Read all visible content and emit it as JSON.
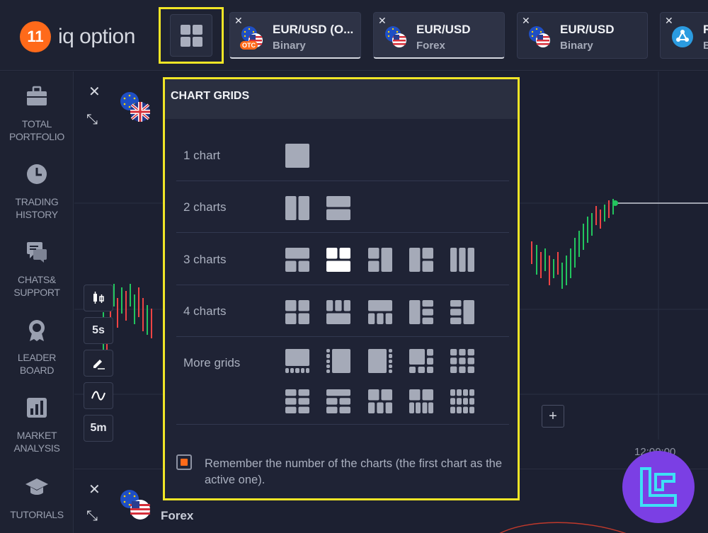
{
  "brand": {
    "logo_mark": "11",
    "name": "iq option"
  },
  "tabs": [
    {
      "title": "EUR/USD (O...",
      "subtitle": "Binary",
      "badge": "OTC"
    },
    {
      "title": "EUR/USD",
      "subtitle": "Forex"
    },
    {
      "title": "EUR/USD",
      "subtitle": "Binary"
    },
    {
      "title": "R",
      "subtitle": "B"
    }
  ],
  "sidebar": {
    "items": [
      {
        "label": "TOTAL\nPORTFOLIO",
        "icon": "briefcase-icon"
      },
      {
        "label": "TRADING\nHISTORY",
        "icon": "clock-icon"
      },
      {
        "label": "CHATS&\nSUPPORT",
        "icon": "chat-icon"
      },
      {
        "label": "LEADER\nBOARD",
        "icon": "medal-icon"
      },
      {
        "label": "MARKET\nANALYSIS",
        "icon": "bar-chart-icon"
      },
      {
        "label": "TUTORIALS",
        "icon": "graduation-cap-icon"
      }
    ]
  },
  "chart_tools": {
    "timeframe": "5s",
    "period": "5m"
  },
  "chart": {
    "time_label": "12:00:00",
    "second_chart_label": "Forex",
    "zoom_in": "+"
  },
  "panel": {
    "title": "CHART GRIDS",
    "rows": [
      {
        "label": "1 chart",
        "icons": 1
      },
      {
        "label": "2 charts",
        "icons": 2
      },
      {
        "label": "3 charts",
        "icons": 5,
        "selected_index": 1
      },
      {
        "label": "4 charts",
        "icons": 5
      },
      {
        "label": "More grids",
        "icons": 10
      }
    ],
    "remember_label": "Remember the number of the charts (the first chart as the active one).",
    "remember_checked": true
  },
  "colors": {
    "accent_orange": "#ff6a1a",
    "highlight_yellow": "#f1e526",
    "candle_green": "#22c55e",
    "candle_red": "#ef4444",
    "brand_badge": "#7b3fe4"
  }
}
